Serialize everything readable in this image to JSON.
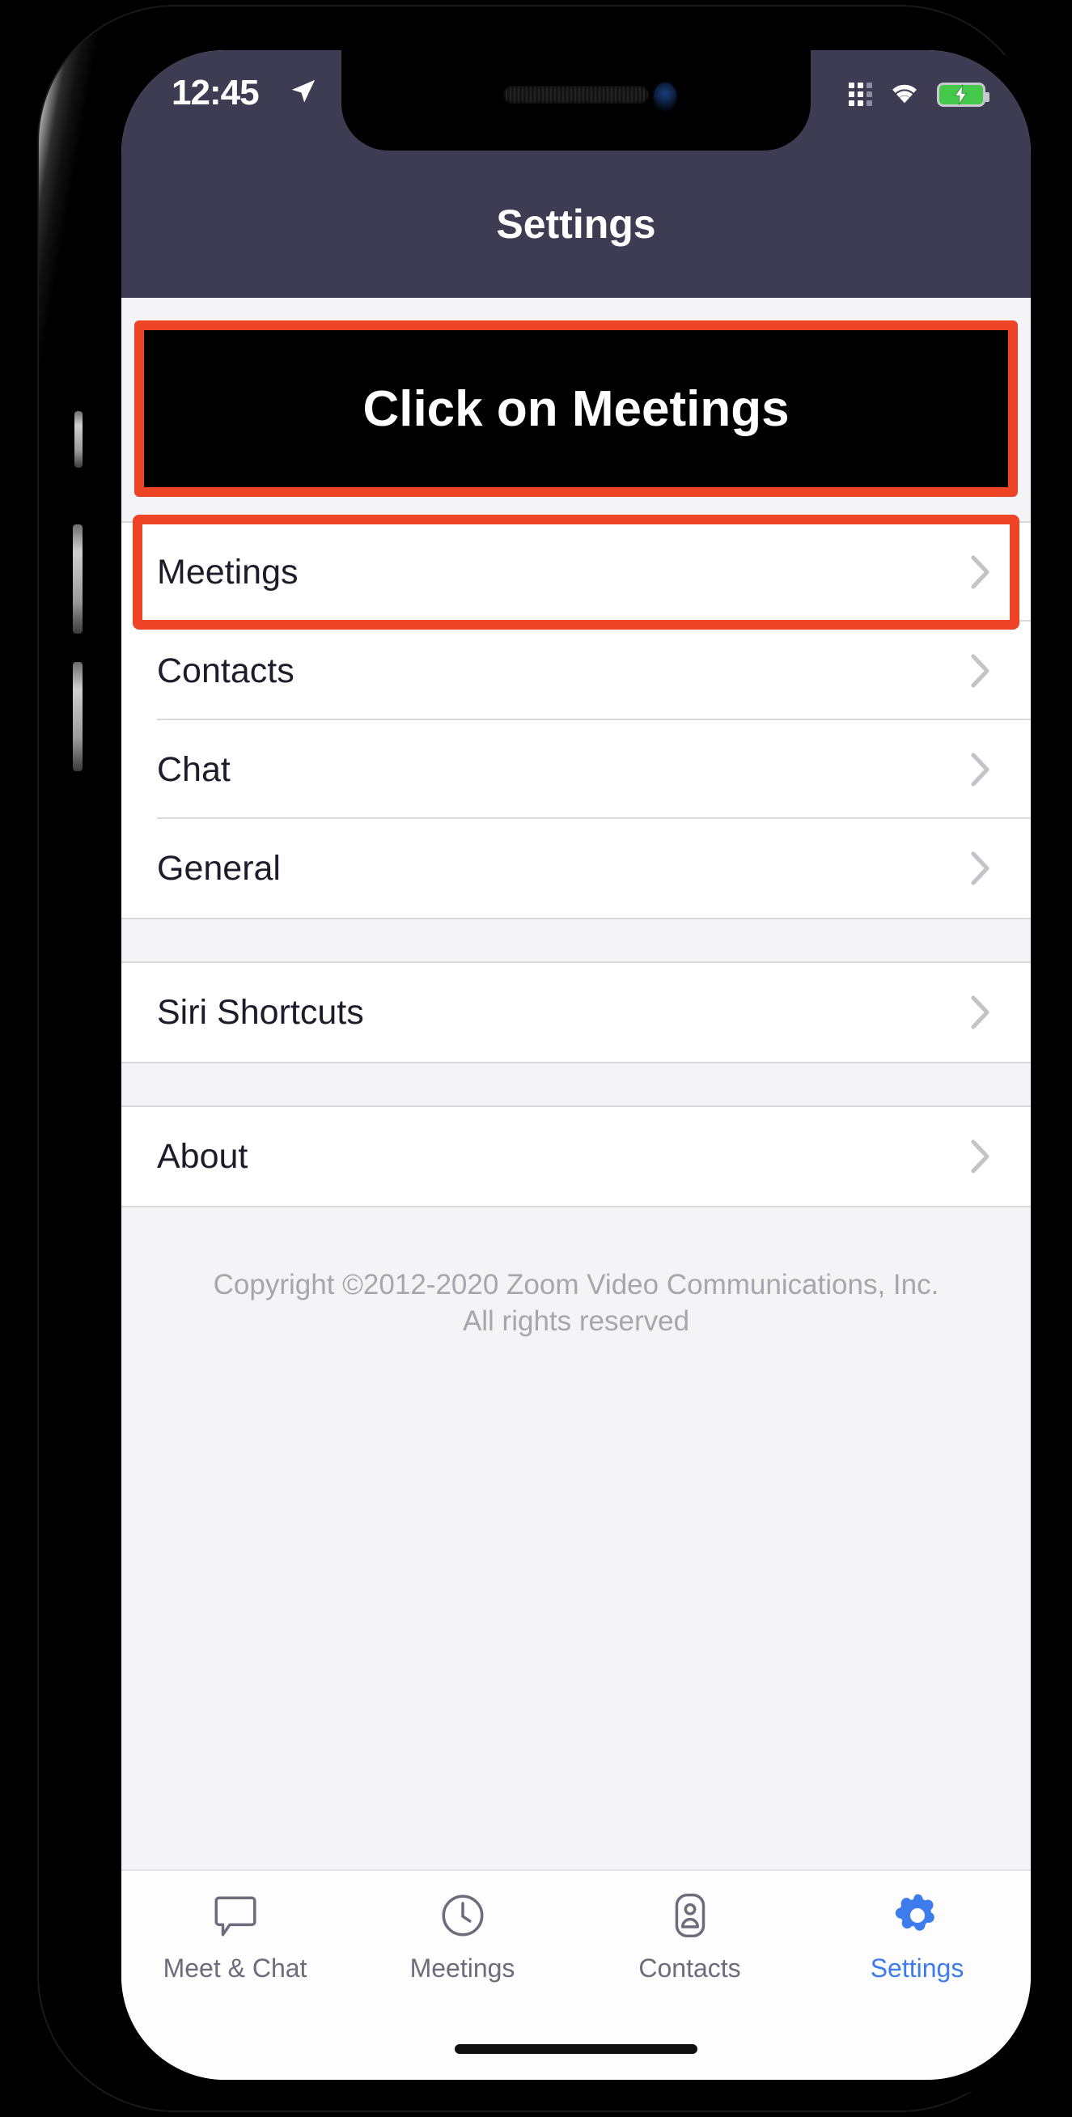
{
  "status_bar": {
    "time": "12:45",
    "location_icon": "location-arrow-icon",
    "signal_icon": "cellular-signal-icon",
    "wifi_icon": "wifi-icon",
    "battery_icon": "battery-charging-icon"
  },
  "nav": {
    "title": "Settings"
  },
  "banner": {
    "text": "Click on Meetings",
    "highlight_color": "#ec4425",
    "background": "#000000",
    "text_color": "#ffffff"
  },
  "groups": [
    {
      "name": "primary",
      "rows": [
        {
          "label": "Meetings",
          "chevron": "chevron-right-icon",
          "highlighted": true
        },
        {
          "label": "Contacts",
          "chevron": "chevron-right-icon",
          "highlighted": false
        },
        {
          "label": "Chat",
          "chevron": "chevron-right-icon",
          "highlighted": false
        },
        {
          "label": "General",
          "chevron": "chevron-right-icon",
          "highlighted": false
        }
      ]
    },
    {
      "name": "siri",
      "rows": [
        {
          "label": "Siri Shortcuts",
          "chevron": "chevron-right-icon",
          "highlighted": false
        }
      ]
    },
    {
      "name": "about",
      "rows": [
        {
          "label": "About",
          "chevron": "chevron-right-icon",
          "highlighted": false
        }
      ]
    }
  ],
  "footer": {
    "line1": "Copyright ©2012-2020 Zoom Video Communications, Inc.",
    "line2": "All rights reserved"
  },
  "tab_bar": {
    "active_color": "#3c7cec",
    "inactive_color": "#6c6c7c",
    "tabs": [
      {
        "label": "Meet & Chat",
        "icon": "chat-bubble-icon",
        "active": false
      },
      {
        "label": "Meetings",
        "icon": "clock-icon",
        "active": false
      },
      {
        "label": "Contacts",
        "icon": "contact-card-icon",
        "active": false
      },
      {
        "label": "Settings",
        "icon": "gear-icon",
        "active": true
      }
    ]
  }
}
